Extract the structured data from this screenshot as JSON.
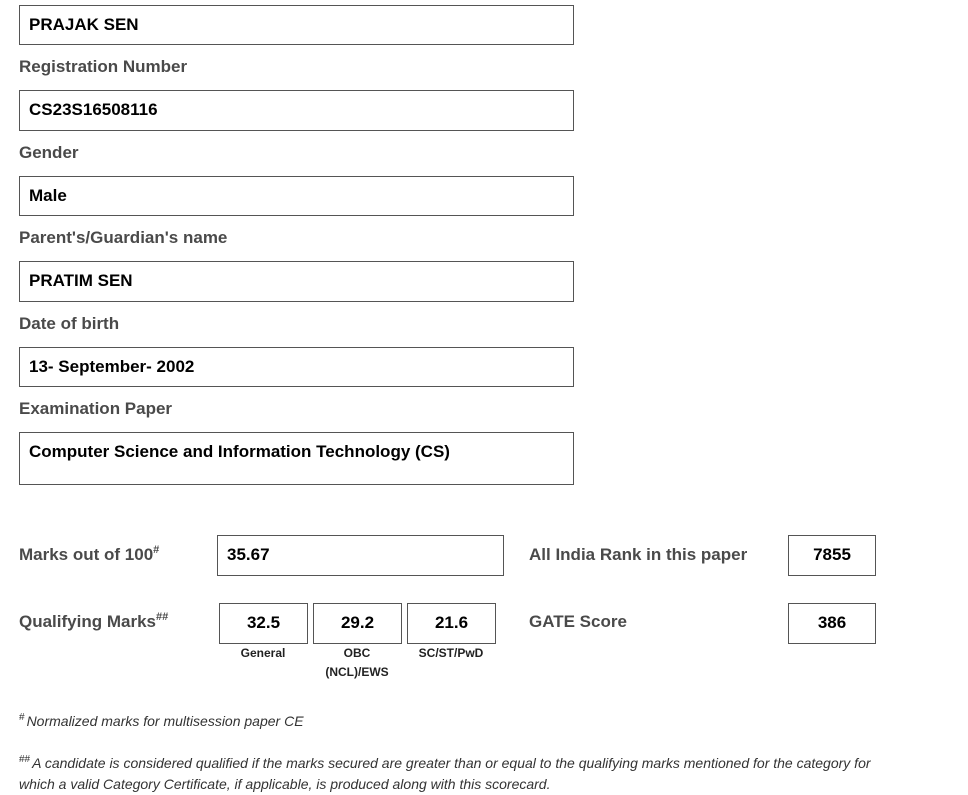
{
  "candidate": {
    "name": "PRAJAK SEN",
    "registration_label": "Registration Number",
    "registration_number": "CS23S16508116",
    "gender_label": "Gender",
    "gender": "Male",
    "guardian_label": "Parent's/Guardian's name",
    "guardian_name": "PRATIM SEN",
    "dob_label": "Date of birth",
    "dob": "13- September- 2002",
    "paper_label": "Examination Paper",
    "paper": "Computer Science and Information Technology (CS)"
  },
  "scores": {
    "marks_label": "Marks out of 100",
    "marks_mark": "#",
    "marks": "35.67",
    "rank_label": "All India Rank in this paper",
    "rank": "7855",
    "qualifying_label": "Qualifying Marks",
    "qualifying_mark": "##",
    "qualifying": [
      {
        "value": "32.5",
        "category_line1": "General",
        "category_line2": ""
      },
      {
        "value": "29.2",
        "category_line1": "OBC",
        "category_line2": "(NCL)/EWS"
      },
      {
        "value": "21.6",
        "category_line1": "SC/ST/PwD",
        "category_line2": ""
      }
    ],
    "gate_label": "GATE Score",
    "gate_score": "386"
  },
  "notes": {
    "note1_mark": "#",
    "note1": "Normalized marks for multisession paper CE",
    "note2_mark": "##",
    "note2": "A candidate is considered qualified if the marks secured are greater than or equal to the qualifying marks mentioned for the category for which a valid Category Certificate, if applicable, is produced along with this scorecard."
  }
}
